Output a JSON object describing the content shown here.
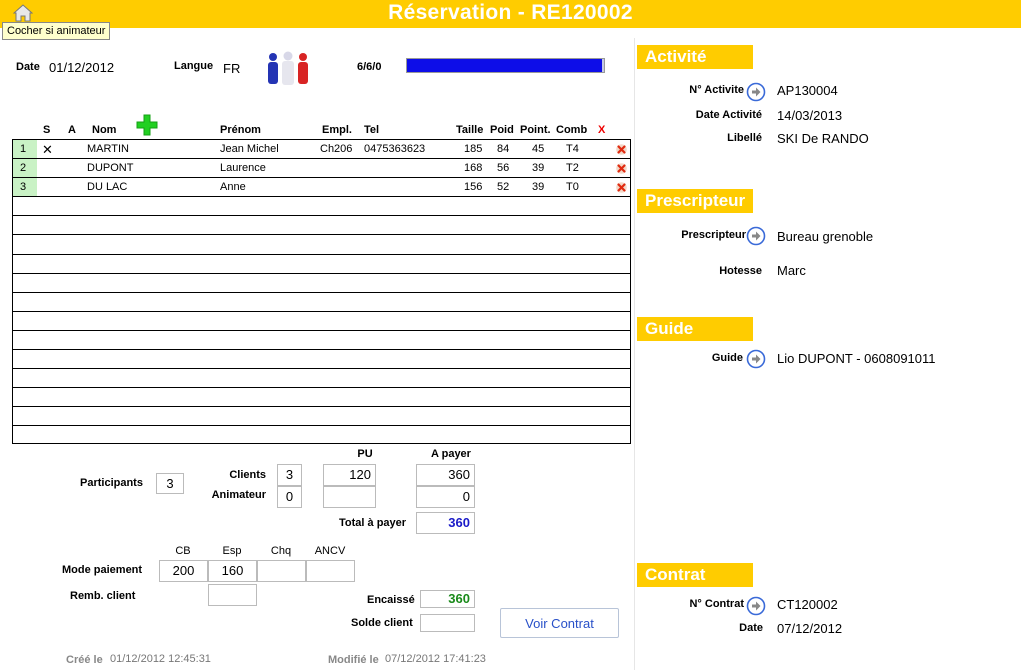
{
  "header": {
    "title": "Réservation - RE120002",
    "tooltip": "Cocher si animateur"
  },
  "info": {
    "date_label": "Date",
    "date_value": "01/12/2012",
    "langue_label": "Langue",
    "langue_value": "FR",
    "progress_text": "6/6/0",
    "progress_fraction": 0.99
  },
  "table": {
    "headers": [
      "S",
      "A",
      "Nom",
      "Prénom",
      "Empl.",
      "Tel",
      "Taille",
      "Poid",
      "Point.",
      "Comb",
      "X"
    ],
    "rows": [
      {
        "num": "1",
        "s": "✕",
        "nom": "MARTIN",
        "prenom": "Jean Michel",
        "empl": "Ch206",
        "tel": "0475363623",
        "taille": "185",
        "poid": "84",
        "point": "45",
        "comb": "T4"
      },
      {
        "num": "2",
        "s": "",
        "nom": "DUPONT",
        "prenom": "Laurence",
        "empl": "",
        "tel": "",
        "taille": "168",
        "poid": "56",
        "point": "39",
        "comb": "T2"
      },
      {
        "num": "3",
        "s": "",
        "nom": "DU LAC",
        "prenom": "Anne",
        "empl": "",
        "tel": "",
        "taille": "156",
        "poid": "52",
        "point": "39",
        "comb": "T0"
      }
    ]
  },
  "totals": {
    "participants_label": "Participants",
    "participants": "3",
    "clients_label": "Clients",
    "clients": "3",
    "animateur_label": "Animateur",
    "animateur": "0",
    "pu_label": "PU",
    "pu_clients": "120",
    "pu_animateur": "",
    "apayer_label": "A payer",
    "apayer_clients": "360",
    "apayer_animateur": "0",
    "total_label": "Total à payer",
    "total": "360"
  },
  "payment": {
    "headers": [
      "CB",
      "Esp",
      "Chq",
      "ANCV"
    ],
    "mode_label": "Mode paiement",
    "values": [
      "200",
      "160",
      "",
      ""
    ],
    "remb_label": "Remb. client",
    "remb": "",
    "encaisse_label": "Encaissé",
    "encaisse": "360",
    "solde_label": "Solde client",
    "solde": "",
    "voir_contrat": "Voir Contrat"
  },
  "footer": {
    "cree_label": "Créé le",
    "cree": "01/12/2012 12:45:31",
    "modifie_label": "Modifié le",
    "modifie": "07/12/2012 17:41:23"
  },
  "activite": {
    "title": "Activité",
    "num_label": "N° Activite",
    "num": "AP130004",
    "date_label": "Date Activité",
    "date": "14/03/2013",
    "libelle_label": "Libellé",
    "libelle": "SKI De RANDO"
  },
  "prescripteur": {
    "title": "Prescripteur",
    "label": "Prescripteur",
    "value": "Bureau grenoble",
    "hotesse_label": "Hotesse",
    "hotesse": "Marc"
  },
  "guide": {
    "title": "Guide",
    "label": "Guide",
    "value": "Lio DUPONT - 0608091011"
  },
  "contrat": {
    "title": "Contrat",
    "num_label": "N° Contrat",
    "num": "CT120002",
    "date_label": "Date",
    "date": "07/12/2012"
  }
}
